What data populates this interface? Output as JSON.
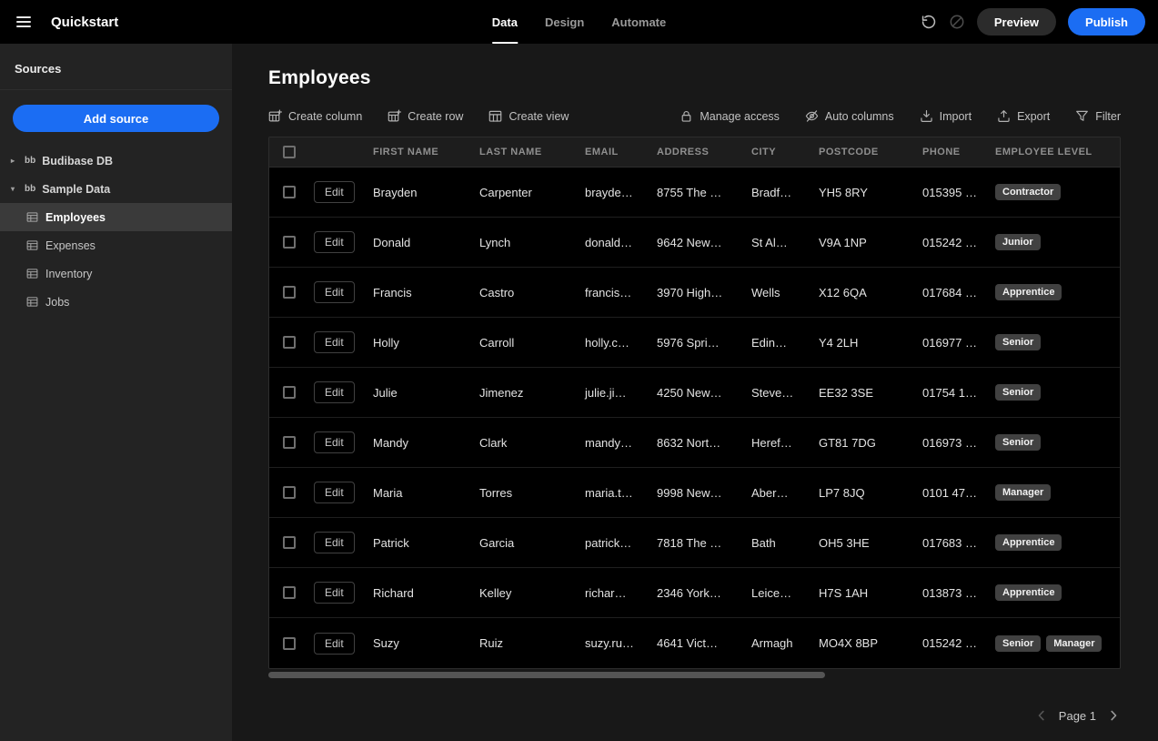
{
  "topbar": {
    "app_title": "Quickstart",
    "tabs": [
      {
        "label": "Data",
        "active": true
      },
      {
        "label": "Design",
        "active": false
      },
      {
        "label": "Automate",
        "active": false
      }
    ],
    "icons": [
      "undo-icon",
      "blocked-icon"
    ],
    "preview_label": "Preview",
    "publish_label": "Publish"
  },
  "sidebar": {
    "header": "Sources",
    "add_source_label": "Add source",
    "sources": [
      {
        "label": "Budibase DB",
        "expanded": false,
        "children": []
      },
      {
        "label": "Sample Data",
        "expanded": true,
        "children": [
          {
            "label": "Employees",
            "selected": true
          },
          {
            "label": "Expenses",
            "selected": false
          },
          {
            "label": "Inventory",
            "selected": false
          },
          {
            "label": "Jobs",
            "selected": false
          }
        ]
      }
    ]
  },
  "main": {
    "title": "Employees",
    "toolbar_left": [
      {
        "label": "Create column",
        "icon": "grid-plus-icon"
      },
      {
        "label": "Create row",
        "icon": "grid-plus-icon"
      },
      {
        "label": "Create view",
        "icon": "grid-icon"
      }
    ],
    "toolbar_right": [
      {
        "label": "Manage access",
        "icon": "lock-icon"
      },
      {
        "label": "Auto columns",
        "icon": "eye-off-icon"
      },
      {
        "label": "Import",
        "icon": "import-icon"
      },
      {
        "label": "Export",
        "icon": "export-icon"
      },
      {
        "label": "Filter",
        "icon": "filter-icon"
      }
    ],
    "table": {
      "edit_label": "Edit",
      "columns": [
        "FIRST NAME",
        "LAST NAME",
        "EMAIL",
        "ADDRESS",
        "CITY",
        "POSTCODE",
        "PHONE",
        "EMPLOYEE LEVEL"
      ],
      "rows": [
        {
          "cells": [
            "Brayden",
            "Carpenter",
            "brayde…",
            "8755 The …",
            "Bradf…",
            "YH5 8RY",
            "015395 …"
          ],
          "levels": [
            "Contractor"
          ]
        },
        {
          "cells": [
            "Donald",
            "Lynch",
            "donald…",
            "9642 New…",
            "St Al…",
            "V9A 1NP",
            "015242 …"
          ],
          "levels": [
            "Junior"
          ]
        },
        {
          "cells": [
            "Francis",
            "Castro",
            "francis…",
            "3970 High…",
            "Wells",
            "X12 6QA",
            "017684 …"
          ],
          "levels": [
            "Apprentice"
          ]
        },
        {
          "cells": [
            "Holly",
            "Carroll",
            "holly.c…",
            "5976 Spri…",
            "Edin…",
            "Y4 2LH",
            "016977 …"
          ],
          "levels": [
            "Senior"
          ]
        },
        {
          "cells": [
            "Julie",
            "Jimenez",
            "julie.ji…",
            "4250 New…",
            "Steve…",
            "EE32 3SE",
            "01754 1…"
          ],
          "levels": [
            "Senior"
          ]
        },
        {
          "cells": [
            "Mandy",
            "Clark",
            "mandy…",
            "8632 Nort…",
            "Heref…",
            "GT81 7DG",
            "016973 …"
          ],
          "levels": [
            "Senior"
          ]
        },
        {
          "cells": [
            "Maria",
            "Torres",
            "maria.t…",
            "9998 New…",
            "Aber…",
            "LP7 8JQ",
            "0101 47…"
          ],
          "levels": [
            "Manager"
          ]
        },
        {
          "cells": [
            "Patrick",
            "Garcia",
            "patrick…",
            "7818 The …",
            "Bath",
            "OH5 3HE",
            "017683 …"
          ],
          "levels": [
            "Apprentice"
          ]
        },
        {
          "cells": [
            "Richard",
            "Kelley",
            "richar…",
            "2346 York…",
            "Leice…",
            "H7S 1AH",
            "013873 …"
          ],
          "levels": [
            "Apprentice"
          ]
        },
        {
          "cells": [
            "Suzy",
            "Ruiz",
            "suzy.ru…",
            "4641 Vict…",
            "Armagh",
            "MO4X 8BP",
            "015242 …"
          ],
          "levels": [
            "Senior",
            "Manager"
          ]
        }
      ]
    },
    "pagination": {
      "label": "Page 1"
    }
  },
  "colors": {
    "accent_blue": "#1b6df3",
    "topbar_bg": "#000000",
    "sidebar_bg": "#232323",
    "main_bg": "#181818",
    "row_bg": "#000000",
    "badge_bg": "#414141"
  }
}
